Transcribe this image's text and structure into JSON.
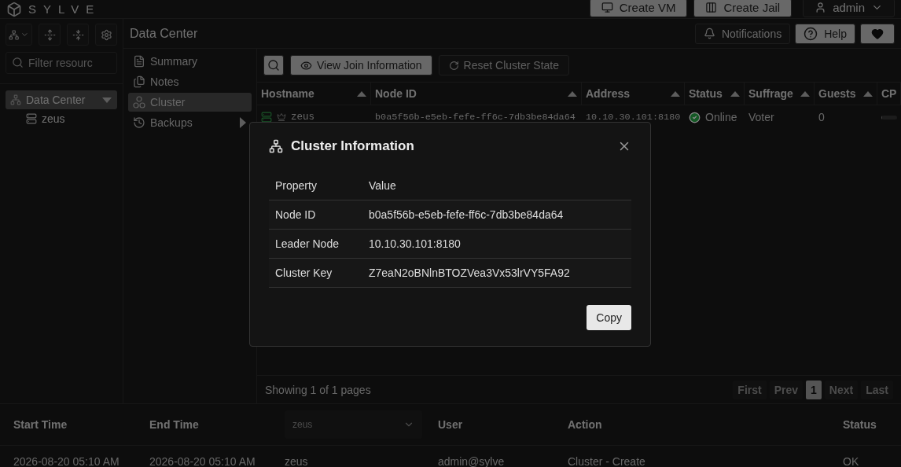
{
  "brand": "SYLVE",
  "top_actions": [
    {
      "label": "Create VM",
      "kind": "vm"
    },
    {
      "label": "Create Jail",
      "kind": "jail"
    }
  ],
  "user": {
    "label": "admin"
  },
  "sidebar": {
    "search": {
      "placeholder": "Filter resourc"
    },
    "tree": [
      {
        "label": "Data Center",
        "selected": true,
        "expanded": true,
        "children": [
          {
            "label": "zeus",
            "selected": false
          }
        ]
      }
    ]
  },
  "header": {
    "title": "Data Center",
    "buttons": [
      {
        "label": "Notifications",
        "kind": "bell"
      },
      {
        "label": "Help",
        "kind": "help"
      }
    ]
  },
  "menu": [
    {
      "label": "Summary",
      "kind": "doc",
      "selected": false,
      "submenu": false
    },
    {
      "label": "Notes",
      "kind": "notes",
      "selected": false,
      "submenu": false
    },
    {
      "label": "Cluster",
      "kind": "cluster",
      "selected": true,
      "submenu": false
    },
    {
      "label": "Backups",
      "kind": "backup",
      "selected": false,
      "submenu": true
    }
  ],
  "toolbar": [
    {
      "label": "View Join Information",
      "kind": "eye",
      "primary": true
    },
    {
      "label": "Reset Cluster State",
      "kind": "reset",
      "primary": false
    }
  ],
  "table": {
    "columns": [
      "Hostname",
      "Node ID",
      "Address",
      "Status",
      "Suffrage",
      "Guests",
      "CP"
    ],
    "rows": [
      {
        "hostname": "zeus",
        "node_id": "b0a5f56b-e5eb-fefe-ff6c-7db3be84da64",
        "address": "10.10.30.101:8180",
        "status": "Online",
        "online": true,
        "suffrage": "Voter",
        "guests": "0",
        "cpu": {
          "level": 0.05
        }
      }
    ]
  },
  "pagination": {
    "summary": "Showing 1 of 1 pages",
    "before": [
      {
        "label": "First",
        "disabled": true
      },
      {
        "label": "Prev",
        "disabled": true
      }
    ],
    "pages": [
      {
        "label": "1",
        "selected": true
      }
    ],
    "after": [
      {
        "label": "Next",
        "disabled": true
      },
      {
        "label": "Last",
        "disabled": true
      }
    ]
  },
  "dialog": {
    "title": "Cluster Information",
    "columns": [
      "Property",
      "Value"
    ],
    "rows": [
      [
        "Node ID",
        "b0a5f56b-e5eb-fefe-ff6c-7db3be84da64"
      ],
      [
        "Leader Node",
        "10.10.30.101:8180"
      ],
      [
        "Cluster Key",
        "Z7eaN2oBNlnBTOZVea3Vx53lrVY5FA92"
      ]
    ],
    "button": "Copy"
  },
  "audit": {
    "columns": [
      {
        "label": "Start Time",
        "kind": "text"
      },
      {
        "label": "End Time",
        "kind": "text"
      },
      {
        "label": "zeus",
        "kind": "filter"
      },
      {
        "label": "User",
        "kind": "text"
      },
      {
        "label": "Action",
        "kind": "text"
      },
      {
        "label": "Status",
        "kind": "text"
      }
    ],
    "rows": [
      [
        "2026-08-20 05:10 AM",
        "2026-08-20 05:10 AM",
        "zeus",
        "admin@sylve",
        "Cluster - Create",
        "OK"
      ]
    ]
  }
}
